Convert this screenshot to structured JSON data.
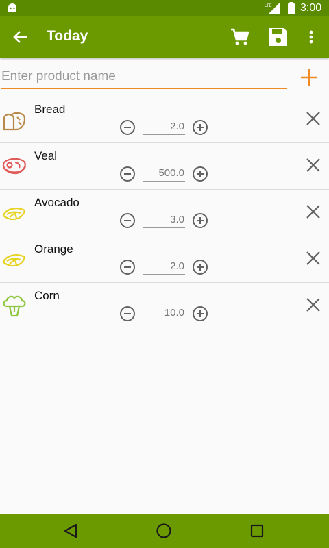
{
  "status_bar": {
    "time": "3:00",
    "network": "LTE"
  },
  "app_bar": {
    "title": "Today"
  },
  "search": {
    "placeholder": "Enter product name",
    "value": ""
  },
  "products": [
    {
      "name": "Bread",
      "quantity": "2.0",
      "icon": "bread-icon",
      "icon_color": "#b8894a"
    },
    {
      "name": "Veal",
      "quantity": "500.0",
      "icon": "steak-icon",
      "icon_color": "#e05a5a"
    },
    {
      "name": "Avocado",
      "quantity": "3.0",
      "icon": "lemon-icon",
      "icon_color": "#e6d422"
    },
    {
      "name": "Orange",
      "quantity": "2.0",
      "icon": "lemon-icon",
      "icon_color": "#e6d422"
    },
    {
      "name": "Corn",
      "quantity": "10.0",
      "icon": "broccoli-icon",
      "icon_color": "#8dc63f"
    }
  ],
  "colors": {
    "primary": "#6a9a00",
    "primary_dark": "#5a8a00",
    "accent": "#f08a24",
    "background": "#fafafa"
  }
}
